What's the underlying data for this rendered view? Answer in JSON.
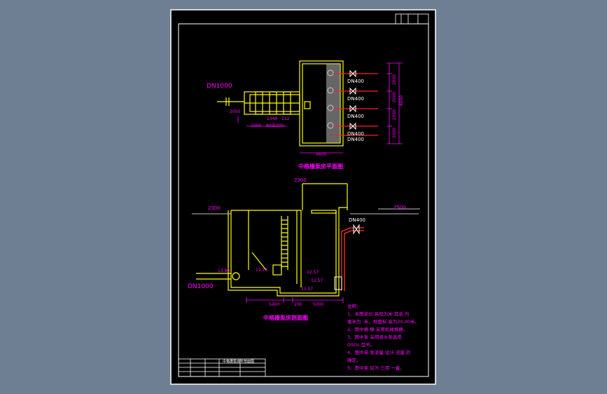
{
  "labels": {
    "dn1000_top": "DN1000",
    "dn1000_bottom": "DN1000",
    "dn400": [
      "DN400",
      "DN400",
      "DN400",
      "DN400",
      "DN400"
    ],
    "dn400_section": "DN400",
    "plan_title": "中格栅泵房平面图",
    "section_title": "中格栅泵房剖面图",
    "dim_1000a": "1000",
    "dim_1000b": "1000",
    "dim_800": "800",
    "dim_1346": "1346",
    "dim_112": "112",
    "dim_2050": "2050",
    "dim_5600": "5600",
    "dim_5400": "5400",
    "dim_200": "200",
    "dim_5000": "5000",
    "dim_2000a": "2000",
    "dim_2000b": "2000",
    "dim_2000c": "2000",
    "dim_2000d": "2000",
    "dim_4000": "4000",
    "elev_2300": "2300",
    "elev_2500": "2500",
    "elev_left": "2300",
    "elev_1380": "13.80",
    "elev_1374": "13.74",
    "elev_1257a": "12.57",
    "elev_1257b": "12.57",
    "elev_1157": "11.57",
    "notes": [
      "说明：",
      "1、本图单位 高程为米 其余 为",
      "毫米为 :米，地面标 高为20.00米。",
      "2、图中格 栅 采用机械格栅。",
      "3、图中泵 采用潜水泵选用",
      "GSGL 型号。",
      "4、图中单 泵流量 设计 流量 的",
      "确定。",
      "5、图中泵 房为 三用 一备。"
    ],
    "title_block_name": "中格栅泵房平剖面图"
  },
  "colors": {
    "background": "#6f7f93",
    "paper": "#000000",
    "frame": "#ffffff",
    "structure": "#ffff00",
    "dimension": "#ff00ff",
    "pipe": "#ff0000",
    "text": "#ff00ff"
  }
}
